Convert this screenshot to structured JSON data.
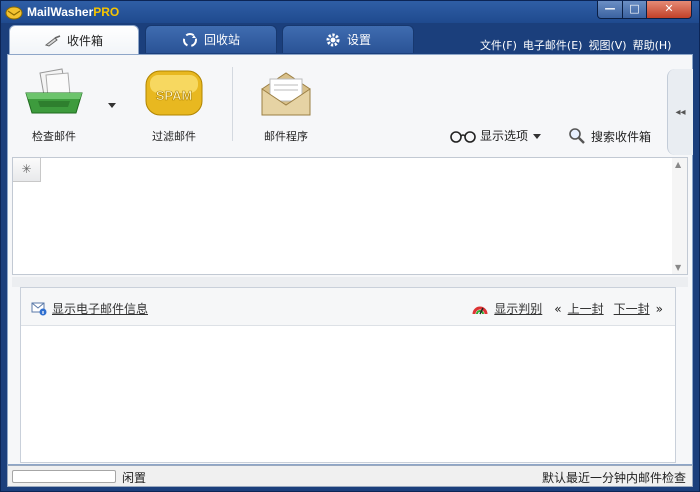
{
  "window": {
    "title_main": "MailWasher",
    "title_suffix": "PRO",
    "minimize_glyph": "—",
    "maximize_glyph": "□",
    "close_glyph": "✕"
  },
  "tabs": [
    {
      "label": "收件箱",
      "icon": "broom-icon",
      "active": true
    },
    {
      "label": "回收站",
      "icon": "recycle-icon",
      "active": false
    },
    {
      "label": "设置",
      "icon": "gear-icon",
      "active": false
    }
  ],
  "menu": [
    "文件(F)",
    "电子邮件(E)",
    "视图(V)",
    "帮助(H)"
  ],
  "toolbar": {
    "check_label": "检查邮件",
    "filter_label": "过滤邮件",
    "spam_text": "SPAM",
    "mailer_label": "邮件程序",
    "display_options": "显示选项",
    "search_inbox": "搜索收件箱"
  },
  "preview": {
    "show_info": "显示电子邮件信息",
    "show_verdict": "显示判别",
    "prev": "上一封",
    "next": "下一封",
    "prev_glyph": "«",
    "next_glyph": "»"
  },
  "status": {
    "left": "闲置",
    "right": "默认最近一分钟内邮件检查"
  },
  "colors": {
    "frame": "#1b3f7c",
    "accent_pro": "#f5c400",
    "close_red": "#c24129"
  }
}
